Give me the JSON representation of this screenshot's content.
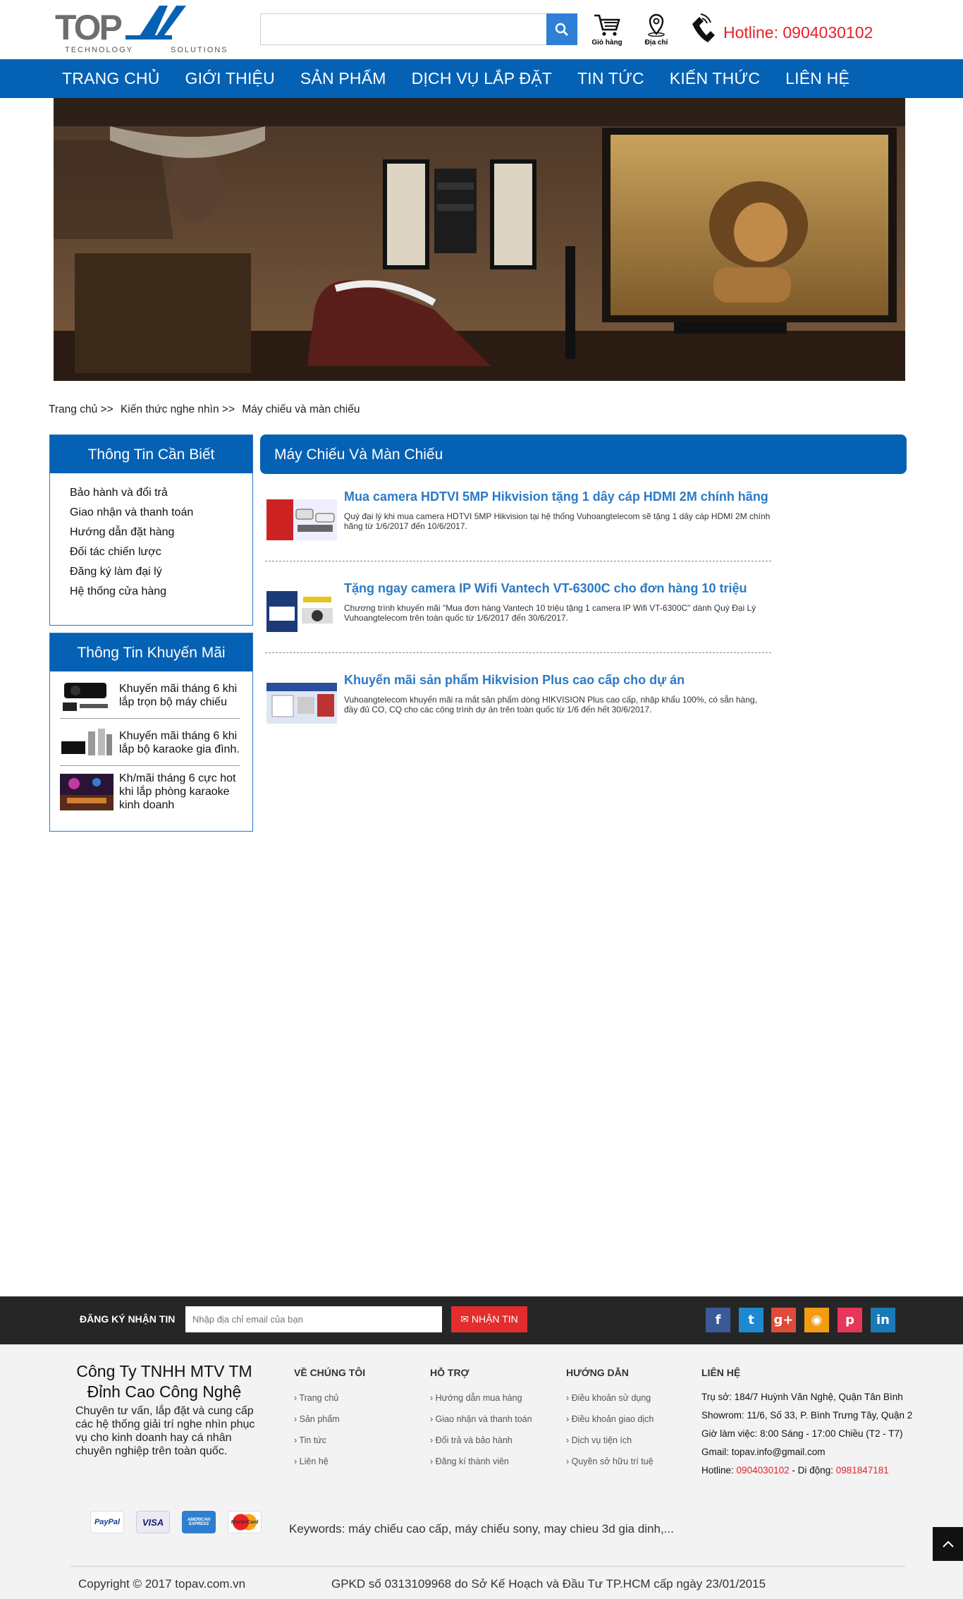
{
  "header": {
    "logo_text": "TOPAV",
    "logo_sub_left": "TECHNOLOGY",
    "logo_sub_right": "SOLUTIONS",
    "search_placeholder": "",
    "cart_label": "Giỏ hàng",
    "address_label": "Địa chỉ",
    "hotline": "Hotline: 0904030102"
  },
  "nav": {
    "items": [
      "TRANG CHỦ",
      "GIỚI THIỆU",
      "SẢN PHẨM",
      "DỊCH VỤ LẮP ĐẶT",
      "TIN TỨC",
      "KIẾN THỨC",
      "LIÊN HỆ"
    ]
  },
  "breadcrumb": {
    "items": [
      "Trang chủ",
      ">>",
      "Kiến thức nghe nhìn",
      ">>",
      "Máy chiếu và màn chiếu"
    ]
  },
  "sidebar": {
    "info_title": "Thông Tin Cần Biết",
    "info_links": [
      "Bảo hành và đổi trả",
      "Giao nhận và thanh toán",
      "Hướng dẫn đặt hàng",
      "Đối tác chiến lược",
      "Đăng ký làm đại lý",
      "Hệ thống cửa hàng"
    ],
    "promo_title": "Thông Tin Khuyến Mãi",
    "promos": [
      "Khuyến mãi tháng 6 khi lắp trọn bộ máy chiếu",
      "Khuyến mãi tháng 6 khi lắp bộ karaoke gia đình.",
      "Kh/mãi tháng 6 cực hot khi lắp phòng karaoke kinh doanh"
    ]
  },
  "main": {
    "title": "Máy Chiếu Và Màn Chiếu",
    "articles": [
      {
        "title": "Mua camera HDTVI 5MP Hikvision tặng 1 dây cáp HDMI 2M chính hãng",
        "desc": "Quý đại lý khi mua camera HDTVI 5MP Hikvision tại hệ thống Vuhoangtelecom sẽ tặng 1 dây cáp HDMI 2M chính hãng từ 1/6/2017 đến 10/6/2017."
      },
      {
        "title": "Tặng ngay camera IP Wifi Vantech VT-6300C cho đơn hàng 10 triệu",
        "desc": "Chương trình khuyến mãi \"Mua đơn hàng Vantech 10 triệu tặng 1 camera IP Wifi VT-6300C\" dành Quý Đại Lý Vuhoangtelecom trên toàn quốc từ 1/6/2017 đến 30/6/2017."
      },
      {
        "title": "Khuyến mãi sản phẩm Hikvision Plus cao cấp cho dự án",
        "desc": "Vuhoangtelecom khuyến mãi ra mắt sản phẩm dòng HIKVISION Plus cao cấp, nhập khẩu 100%, có sẵn hàng, đầy đủ CO, CQ cho các công trình dự án trên toàn quốc từ 1/6 đến hết 30/6/2017."
      }
    ]
  },
  "subscribe": {
    "label": "ĐĂNG KÝ NHẬN TIN",
    "placeholder": "Nhập địa chỉ email của bạn",
    "button": "NHẬN TIN"
  },
  "social": {
    "icons": [
      "facebook-icon",
      "twitter-icon",
      "google-plus-icon",
      "rss-icon",
      "pinterest-icon",
      "linkedin-icon"
    ],
    "colors": [
      "#3b5998",
      "#1e88d2",
      "#dd4b39",
      "#f39c12",
      "#e6375a",
      "#1a7ab8"
    ],
    "glyphs": [
      "f",
      "t",
      "g+",
      "◉",
      "p",
      "in"
    ]
  },
  "footer": {
    "company_name": "Công Ty TNHH MTV TM Đỉnh Cao Công Nghệ",
    "company_desc": "Chuyên tư vấn, lắp đặt và cung cấp các hệ thống giải trí nghe nhìn phục vụ cho kinh doanh hay cá nhân chuyên nghiệp trên toàn quốc.",
    "about_title": "VỀ CHÚNG TÔI",
    "about_links": [
      "Trang chủ",
      "Sản phẩm",
      "Tin tức",
      "Liên hệ"
    ],
    "support_title": "HỖ TRỢ",
    "support_links": [
      "Hướng dẫn mua hàng",
      "Giao nhận và thanh toán",
      "Đổi trả và bảo hành",
      "Đăng kí thành viên"
    ],
    "guide_title": "HƯỚNG DẪN",
    "guide_links": [
      "Điều khoản sử dụng",
      "Điều khoản giao dịch",
      "Dịch vụ tiện ích",
      "Quyền sở hữu trí tuệ"
    ],
    "contact_title": "LIÊN HỆ",
    "contact_office": "Trụ sở: 184/7 Huỳnh Văn Nghệ, Quận Tân Bình",
    "contact_showroom": "Showrom: 11/6, Số 33, P. Bình Trưng Tây, Quận 2",
    "contact_hours": "Giờ làm việc: 8:00 Sáng - 17:00 Chiều (T2 - T7)",
    "contact_gmail": "Gmail: topav.info@gmail.com",
    "hotline_label": "Hotline:",
    "hotline_number": "0904030102",
    "mobile_label": "- Di động:",
    "mobile_number": "0981847181",
    "payments": [
      "PayPal",
      "VISA",
      "AMERICAN EXPRESS",
      "MasterCard"
    ],
    "keywords": "Keywords: máy chiếu cao cấp, máy chiếu sony, may chieu 3d gia dinh,...",
    "copyright": "Copyright © 2017 topav.com.vn",
    "gpkd": "GPKD số 0313109968 do Sở Kế Hoạch và Đầu Tư TP.HCM cấp ngày 23/01/2015"
  }
}
